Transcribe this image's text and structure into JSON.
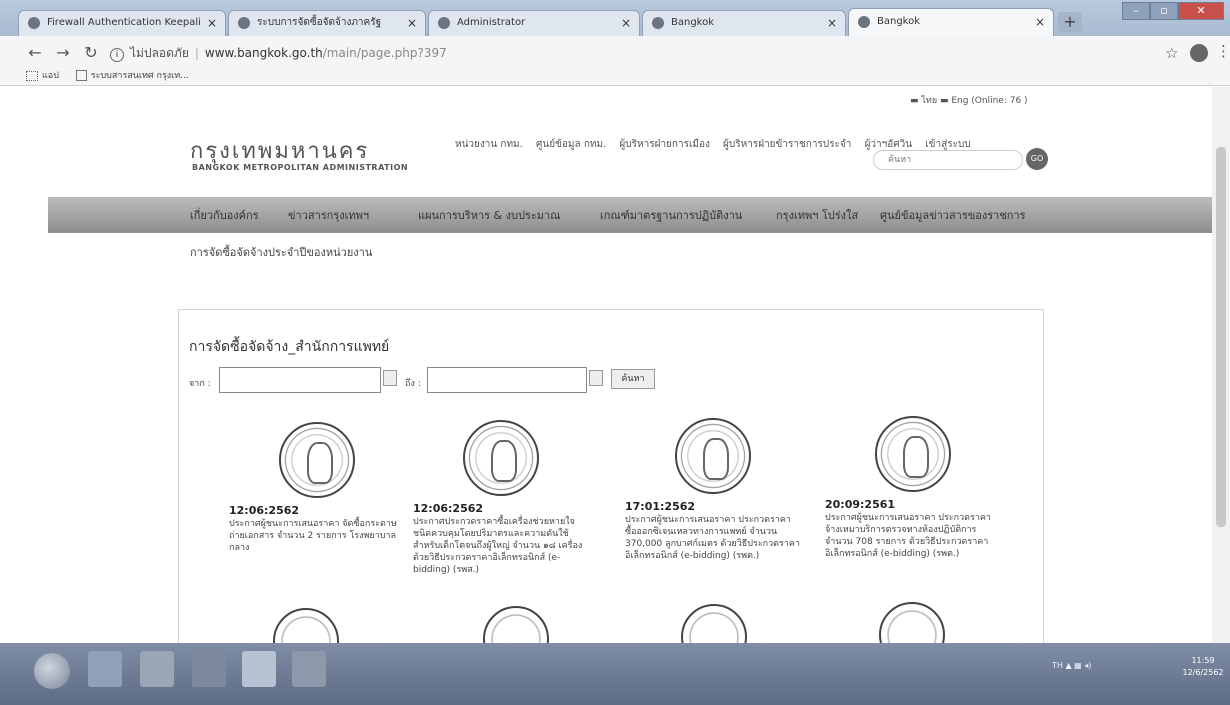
{
  "tabs": [
    {
      "title": "Firewall Authentication Keepali",
      "active": false
    },
    {
      "title": "ระบบการจัดซื้อจัดจ้างภาครัฐ",
      "active": false
    },
    {
      "title": "Administrator",
      "active": false
    },
    {
      "title": "Bangkok",
      "active": false
    },
    {
      "title": "Bangkok",
      "active": true
    }
  ],
  "window_controls": {
    "minimize": "–",
    "maximize": "▫",
    "close": "✕"
  },
  "toolbar": {
    "security_label": "ไม่ปลอดภัย",
    "url_host": "www.bangkok.go.th",
    "url_path": "/main/page.php?397"
  },
  "bookmarks": {
    "apps": "แอป",
    "item1": "ระบบสารสนเทศ กรุงเท..."
  },
  "page": {
    "langs": "▬ ไทย  ▬ Eng  (Online: 76 )",
    "brand_th": "กรุงเทพมหานคร",
    "brand_en": "BANGKOK METROPOLITAN ADMINISTRATION",
    "toplinks": [
      "หน่วยงาน กทม.",
      "ศูนย์ข้อมูล กทม.",
      "ผู้บริหารฝ่ายการเมือง",
      "ผู้บริหารฝ่ายข้าราชการประจำ",
      "ผู้ว่าฯอัศวิน",
      "เข้าสู่ระบบ"
    ],
    "search_placeholder": "ค้นหา",
    "go_label": "GO",
    "nav": [
      "เกี่ยวกับองค์กร",
      "ข่าวสารกรุงเทพฯ",
      "แผนการบริหาร & งบประมาณ",
      "เกณฑ์มาตรฐานการปฏิบัติงาน",
      "กรุงเทพฯ โปร่งใส",
      "ศูนย์ข้อมูลข่าวสารของราชการ"
    ],
    "breadcrumb": "การจัดซื้อจัดจ้างประจำปีของหน่วยงาน",
    "panel_title": "การจัดซื้อจัดจ้าง_สำนักการแพทย์",
    "from_label": "จาก :",
    "to_label": "ถึง :",
    "search_button": "ค้นหา",
    "items": [
      {
        "date": "12:06:2562",
        "desc": "ประกาศผู้ชนะการเสนอราคา จัดซื้อกระดาษถ่ายเอกสาร จำนวน 2 รายการ โรงพยาบาลกลาง"
      },
      {
        "date": "12:06:2562",
        "desc": "ประกาศประกวดราคาซื้อเครื่องช่วยหายใจชนิดควบคุมโดยปริมาตรและความดันใช้สำหรับเด็กโตจนถึงผู้ใหญ่ จำนวน ๑๘ เครื่อง ด้วยวิธีประกวดราคาอิเล็กทรอนิกส์ (e-bidding) (รพส.)"
      },
      {
        "date": "17:01:2562",
        "desc": "ประกาศผู้ชนะการเสนอราคา ประกวดราคาซื้อออกซิเจนเหลวทางการแพทย์ จำนวน 370,000 ลูกบาศก์เมตร ด้วยวิธีประกวดราคาอิเล็กทรอนิกส์ (e-bidding) (รพต.)"
      },
      {
        "date": "20:09:2561",
        "desc": "ประกาศผู้ชนะการเสนอราคา ประกวดราคาจ้างเหมาบริการตรวจทางห้องปฏิบัติการ จำนวน 708 รายการ ด้วยวิธีประกวดราคาอิเล็กทรอนิกส์ (e-bidding) (รพต.)"
      }
    ]
  },
  "taskbar": {
    "lang": "TH",
    "time": "11:59",
    "date": "12/6/2562"
  }
}
